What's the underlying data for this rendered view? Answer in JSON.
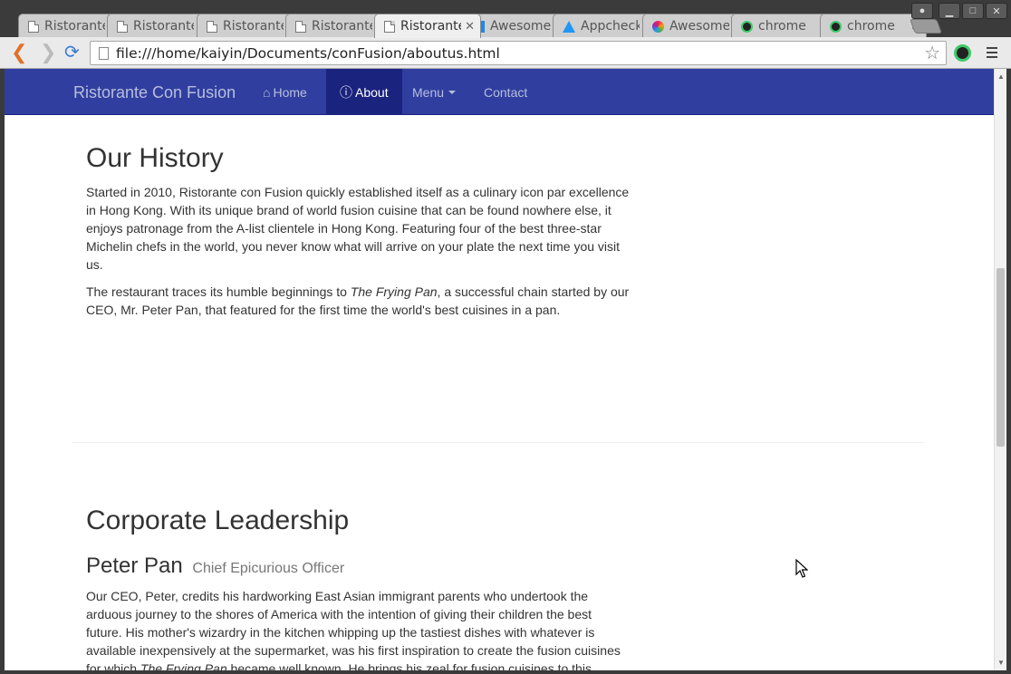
{
  "browser": {
    "tabs": [
      {
        "title": "Ristorante Con Fusion",
        "icon": "document-icon",
        "active": false
      },
      {
        "title": "Ristorante Con Fusion",
        "icon": "document-icon",
        "active": false
      },
      {
        "title": "Ristorante Con Fusion",
        "icon": "document-icon",
        "active": false
      },
      {
        "title": "Ristorante Con Fusion",
        "icon": "document-icon",
        "active": false
      },
      {
        "title": "Ristorante Con Fusion",
        "icon": "document-icon",
        "active": true
      },
      {
        "title": "Awesome",
        "icon": "awesome-favicon-icon",
        "active": false
      },
      {
        "title": "Appcheck",
        "icon": "appcheck-favicon-icon",
        "active": false
      },
      {
        "title": "Awesome",
        "icon": "instagram-favicon-icon",
        "active": false
      },
      {
        "title": "chrome",
        "icon": "chrome-app-icon",
        "active": false
      },
      {
        "title": "chrome",
        "icon": "chrome-app-icon",
        "active": false
      }
    ],
    "url": "file:///home/kaiyin/Documents/conFusion/aboutus.html"
  },
  "navbar": {
    "brand": "Ristorante Con Fusion",
    "items": [
      {
        "label": "Home",
        "icon": "home-icon"
      },
      {
        "label": "About",
        "icon": "info-circle-icon"
      },
      {
        "label": "Menu",
        "icon": "caret-down-icon"
      },
      {
        "label": "Contact"
      }
    ],
    "color": "#303f9f",
    "active_color": "#1a237e"
  },
  "history": {
    "heading": "Our History",
    "p1": "Started in 2010, Ristorante con Fusion quickly established itself as a culinary icon par excellence in Hong Kong. With its unique brand of world fusion cuisine that can be found nowhere else, it enjoys patronage from the A-list clientele in Hong Kong. Featuring four of the best three-star Michelin chefs in the world, you never know what will arrive on your plate the next time you visit us.",
    "p2_before": "The restaurant traces its humble beginnings to ",
    "p2_em": "The Frying Pan",
    "p2_after": ", a successful chain started by our CEO, Mr. Peter Pan, that featured for the first time the world's best cuisines in a pan."
  },
  "leadership": {
    "heading": "Corporate Leadership",
    "person_name": "Peter Pan",
    "person_title": "Chief Epicurious Officer",
    "bio_before": "Our CEO, Peter, credits his hardworking East Asian immigrant parents who undertook the arduous journey to the shores of America with the intention of giving their children the best future. His mother's wizardry in the kitchen whipping up the tastiest dishes with whatever is available inexpensively at the supermarket, was his first inspiration to create the fusion cuisines for which ",
    "bio_em": "The Frying Pan",
    "bio_after": " became well known. He brings his zeal for fusion cuisines to this restaurant, pioneering cross-cultural culinary connections."
  }
}
